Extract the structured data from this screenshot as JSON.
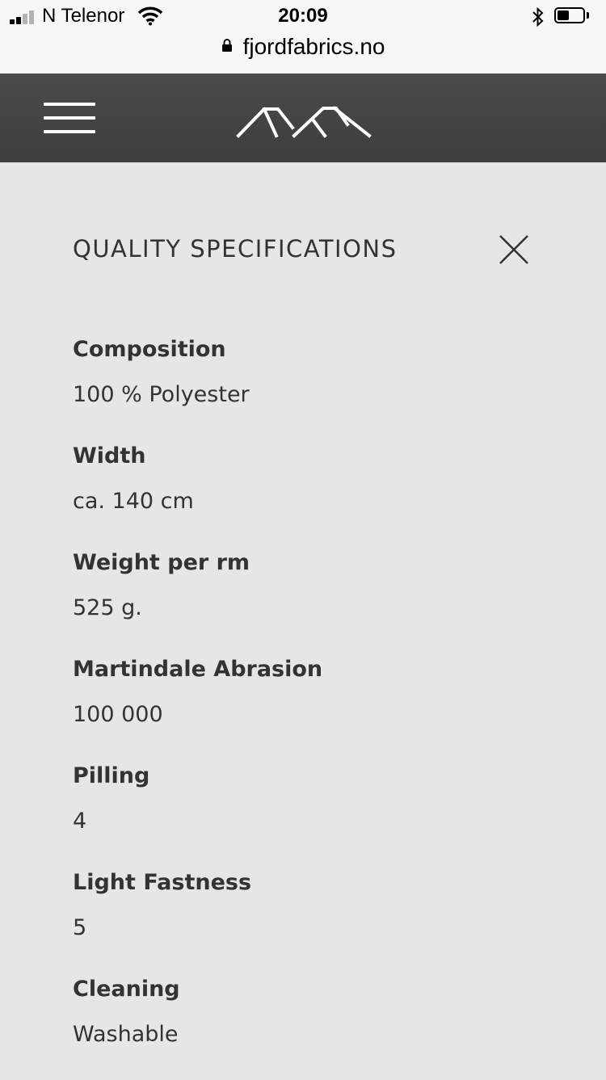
{
  "status_bar": {
    "carrier": "N Telenor",
    "time": "20:09",
    "battery_level": 0.45
  },
  "url_bar": {
    "url": "fjordfabrics.no"
  },
  "header": {
    "menu_icon": "hamburger-menu-icon",
    "logo_icon": "mountains-logo-icon"
  },
  "panel": {
    "title": "QUALITY SPECIFICATIONS",
    "close_icon": "close-icon",
    "specs": [
      {
        "label": "Composition",
        "value": "100 % Polyester"
      },
      {
        "label": "Width",
        "value": "ca. 140 cm"
      },
      {
        "label": "Weight per rm",
        "value": "525 g."
      },
      {
        "label": "Martindale Abrasion",
        "value": "100 000"
      },
      {
        "label": "Pilling",
        "value": "4"
      },
      {
        "label": "Light Fastness",
        "value": "5"
      },
      {
        "label": "Cleaning",
        "value": "Washable"
      }
    ]
  },
  "colors": {
    "header_bg": "#454545",
    "panel_bg": "#e6e6e6",
    "text": "#333333"
  }
}
